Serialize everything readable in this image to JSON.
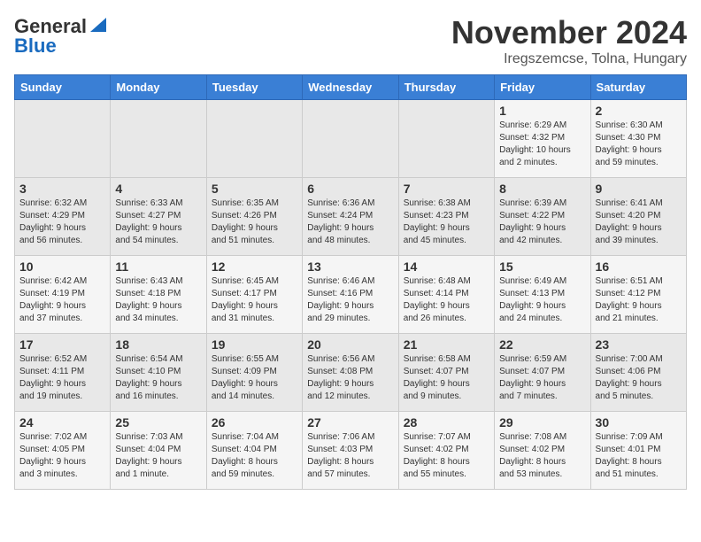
{
  "header": {
    "logo_general": "General",
    "logo_blue": "Blue",
    "title": "November 2024",
    "subtitle": "Iregszemcse, Tolna, Hungary"
  },
  "weekdays": [
    "Sunday",
    "Monday",
    "Tuesday",
    "Wednesday",
    "Thursday",
    "Friday",
    "Saturday"
  ],
  "weeks": [
    [
      {
        "day": "",
        "info": ""
      },
      {
        "day": "",
        "info": ""
      },
      {
        "day": "",
        "info": ""
      },
      {
        "day": "",
        "info": ""
      },
      {
        "day": "",
        "info": ""
      },
      {
        "day": "1",
        "info": "Sunrise: 6:29 AM\nSunset: 4:32 PM\nDaylight: 10 hours\nand 2 minutes."
      },
      {
        "day": "2",
        "info": "Sunrise: 6:30 AM\nSunset: 4:30 PM\nDaylight: 9 hours\nand 59 minutes."
      }
    ],
    [
      {
        "day": "3",
        "info": "Sunrise: 6:32 AM\nSunset: 4:29 PM\nDaylight: 9 hours\nand 56 minutes."
      },
      {
        "day": "4",
        "info": "Sunrise: 6:33 AM\nSunset: 4:27 PM\nDaylight: 9 hours\nand 54 minutes."
      },
      {
        "day": "5",
        "info": "Sunrise: 6:35 AM\nSunset: 4:26 PM\nDaylight: 9 hours\nand 51 minutes."
      },
      {
        "day": "6",
        "info": "Sunrise: 6:36 AM\nSunset: 4:24 PM\nDaylight: 9 hours\nand 48 minutes."
      },
      {
        "day": "7",
        "info": "Sunrise: 6:38 AM\nSunset: 4:23 PM\nDaylight: 9 hours\nand 45 minutes."
      },
      {
        "day": "8",
        "info": "Sunrise: 6:39 AM\nSunset: 4:22 PM\nDaylight: 9 hours\nand 42 minutes."
      },
      {
        "day": "9",
        "info": "Sunrise: 6:41 AM\nSunset: 4:20 PM\nDaylight: 9 hours\nand 39 minutes."
      }
    ],
    [
      {
        "day": "10",
        "info": "Sunrise: 6:42 AM\nSunset: 4:19 PM\nDaylight: 9 hours\nand 37 minutes."
      },
      {
        "day": "11",
        "info": "Sunrise: 6:43 AM\nSunset: 4:18 PM\nDaylight: 9 hours\nand 34 minutes."
      },
      {
        "day": "12",
        "info": "Sunrise: 6:45 AM\nSunset: 4:17 PM\nDaylight: 9 hours\nand 31 minutes."
      },
      {
        "day": "13",
        "info": "Sunrise: 6:46 AM\nSunset: 4:16 PM\nDaylight: 9 hours\nand 29 minutes."
      },
      {
        "day": "14",
        "info": "Sunrise: 6:48 AM\nSunset: 4:14 PM\nDaylight: 9 hours\nand 26 minutes."
      },
      {
        "day": "15",
        "info": "Sunrise: 6:49 AM\nSunset: 4:13 PM\nDaylight: 9 hours\nand 24 minutes."
      },
      {
        "day": "16",
        "info": "Sunrise: 6:51 AM\nSunset: 4:12 PM\nDaylight: 9 hours\nand 21 minutes."
      }
    ],
    [
      {
        "day": "17",
        "info": "Sunrise: 6:52 AM\nSunset: 4:11 PM\nDaylight: 9 hours\nand 19 minutes."
      },
      {
        "day": "18",
        "info": "Sunrise: 6:54 AM\nSunset: 4:10 PM\nDaylight: 9 hours\nand 16 minutes."
      },
      {
        "day": "19",
        "info": "Sunrise: 6:55 AM\nSunset: 4:09 PM\nDaylight: 9 hours\nand 14 minutes."
      },
      {
        "day": "20",
        "info": "Sunrise: 6:56 AM\nSunset: 4:08 PM\nDaylight: 9 hours\nand 12 minutes."
      },
      {
        "day": "21",
        "info": "Sunrise: 6:58 AM\nSunset: 4:07 PM\nDaylight: 9 hours\nand 9 minutes."
      },
      {
        "day": "22",
        "info": "Sunrise: 6:59 AM\nSunset: 4:07 PM\nDaylight: 9 hours\nand 7 minutes."
      },
      {
        "day": "23",
        "info": "Sunrise: 7:00 AM\nSunset: 4:06 PM\nDaylight: 9 hours\nand 5 minutes."
      }
    ],
    [
      {
        "day": "24",
        "info": "Sunrise: 7:02 AM\nSunset: 4:05 PM\nDaylight: 9 hours\nand 3 minutes."
      },
      {
        "day": "25",
        "info": "Sunrise: 7:03 AM\nSunset: 4:04 PM\nDaylight: 9 hours\nand 1 minute."
      },
      {
        "day": "26",
        "info": "Sunrise: 7:04 AM\nSunset: 4:04 PM\nDaylight: 8 hours\nand 59 minutes."
      },
      {
        "day": "27",
        "info": "Sunrise: 7:06 AM\nSunset: 4:03 PM\nDaylight: 8 hours\nand 57 minutes."
      },
      {
        "day": "28",
        "info": "Sunrise: 7:07 AM\nSunset: 4:02 PM\nDaylight: 8 hours\nand 55 minutes."
      },
      {
        "day": "29",
        "info": "Sunrise: 7:08 AM\nSunset: 4:02 PM\nDaylight: 8 hours\nand 53 minutes."
      },
      {
        "day": "30",
        "info": "Sunrise: 7:09 AM\nSunset: 4:01 PM\nDaylight: 8 hours\nand 51 minutes."
      }
    ]
  ]
}
